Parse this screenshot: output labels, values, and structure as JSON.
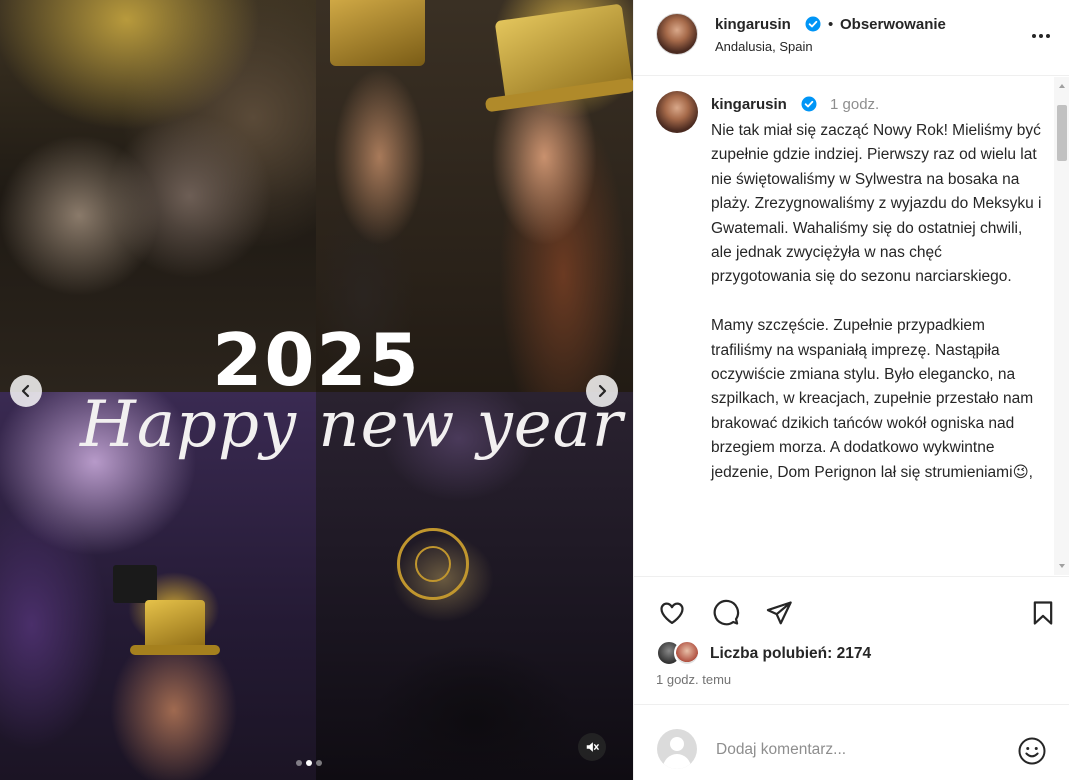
{
  "media": {
    "overlay_year": "2025",
    "overlay_greeting": "Happy new year",
    "carousel_slide_index": 2,
    "carousel_slide_count": 3
  },
  "header": {
    "username": "kingarusin",
    "separator": "•",
    "follow_label": "Obserwowanie",
    "location": "Andalusia, Spain"
  },
  "caption": {
    "username": "kingarusin",
    "time_ago": "1 godz.",
    "text": "Nie tak miał się zacząć Nowy Rok! Mieliśmy być zupełnie gdzie indziej. Pierwszy raz od wielu lat nie świętowaliśmy w Sylwestra na bosaka na plaży. Zrezygnowaliśmy z wyjazdu do Meksyku i Gwatemali. Wahaliśmy się do ostatniej chwili, ale jednak zwyciężyła w nas chęć przygotowania się do sezonu narciarskiego.\n\nMamy szczęście. Zupełnie przypadkiem trafiliśmy na wspaniałą imprezę. Nastąpiła oczywiście zmiana stylu. Było elegancko, na szpilkach, w kreacjach, zupełnie przestało nam brakować dzikich tańców wokół ogniska nad brzegiem morza. A dodatkowo wykwintne jedzenie, Dom Perignon lał się strumieniami😉,"
  },
  "engagement": {
    "likes_label": "Liczba polubień: 2174",
    "posted_label": "1 godz. temu"
  },
  "add_comment": {
    "placeholder": "Dodaj komentarz..."
  },
  "colors": {
    "verified_blue": "#0095f6",
    "text_primary": "#262626",
    "text_secondary": "#737373"
  }
}
